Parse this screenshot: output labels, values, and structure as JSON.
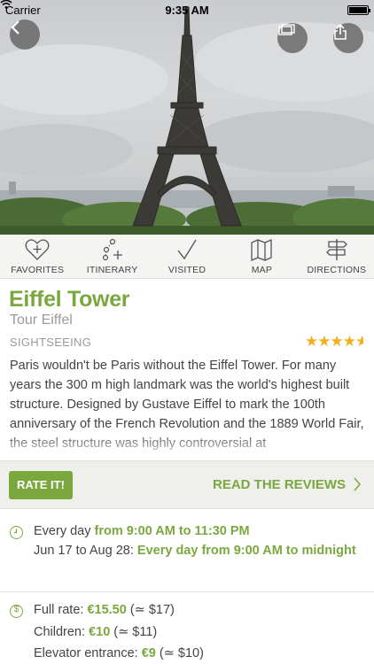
{
  "status_bar": {
    "carrier": "Carrier",
    "time": "9:35 AM",
    "battery_level": 1.0
  },
  "hero": {
    "image_subject": "Eiffel Tower",
    "back_icon": "chevron-left-icon",
    "ticket_icon": "ticket-icon",
    "share_icon": "share-icon"
  },
  "actions": [
    {
      "label": "FAVORITES",
      "icon": "heart-plus-icon"
    },
    {
      "label": "ITINERARY",
      "icon": "itinerary-icon"
    },
    {
      "label": "VISITED",
      "icon": "checkmark-icon"
    },
    {
      "label": "MAP",
      "icon": "map-icon"
    },
    {
      "label": "DIRECTIONS",
      "icon": "signpost-icon"
    }
  ],
  "place": {
    "title": "Eiffel Tower",
    "subtitle": "Tour Eiffel",
    "category": "SIGHTSEEING",
    "rating": 4.5,
    "description": "Paris wouldn't be Paris without the Eiffel Tower. For many years the 300 m high landmark was the world's highest built structure. Designed by Gustave Eiffel to mark the 100th anniversary of the French Revolution and the 1889 World Fair, the steel structure was highly controversial at"
  },
  "rate_bar": {
    "rate_label": "RATE IT!",
    "reviews_label": "READ THE REVIEWS"
  },
  "hours": {
    "line1_prefix": "Every day ",
    "line1_hours": "from 9:00 AM to 11:30 PM",
    "line2_prefix": "Jun 17 to Aug 28: ",
    "line2_hours": "Every day from 9:00 AM to midnight"
  },
  "prices": {
    "full_label": "Full rate: ",
    "full_value": "€15.50",
    "full_approx": " (≃ $17)",
    "children_label": "Children: ",
    "children_value": "€10",
    "children_approx": " (≃ $11)",
    "elevator_label": "Elevator entrance: ",
    "elevator_value": "€9",
    "elevator_approx": " (≃ $10)"
  },
  "colors": {
    "accent": "#7aa83e",
    "star": "#f2b01e"
  }
}
